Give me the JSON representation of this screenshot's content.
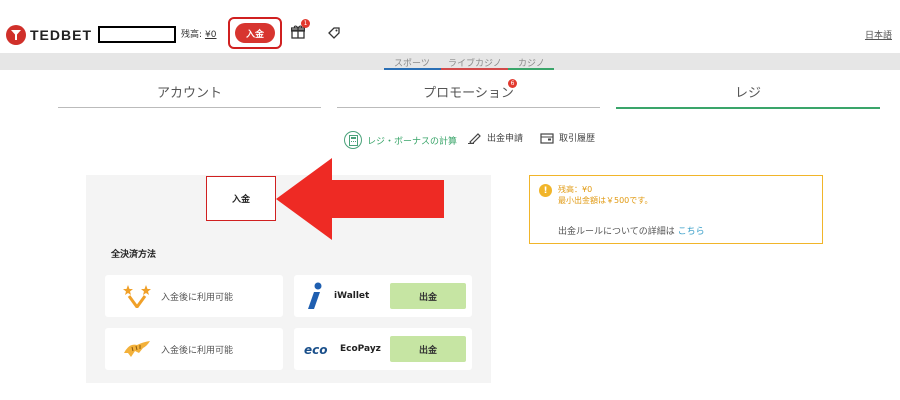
{
  "header": {
    "logo_text": "TEDBET",
    "balance_label": "残高:",
    "balance_value": "¥0",
    "deposit_label": "入金",
    "gift_badge": "1",
    "language": "日本語"
  },
  "top_nav": {
    "items": [
      {
        "label": "スポーツ",
        "color": "#2a6fb5"
      },
      {
        "label": "ライブカジノ",
        "color": "#d24a4a"
      },
      {
        "label": "カジノ",
        "color": "#3aa56a"
      }
    ]
  },
  "tabs": [
    {
      "label": "アカウント",
      "active": false
    },
    {
      "label": "プロモーション",
      "active": false,
      "badge": "6"
    },
    {
      "label": "レジ",
      "active": true
    }
  ],
  "sub_actions": [
    {
      "label": "レジ・ボーナスの計算",
      "icon": "calculator-icon"
    },
    {
      "label": "出金申請",
      "icon": "pen-icon"
    },
    {
      "label": "取引履歴",
      "icon": "wallet-icon"
    }
  ],
  "panel": {
    "deposit_tab": "入金",
    "section_title": "全決済方法",
    "left_cards": [
      {
        "label": "入金後に利用可能",
        "icon": "vip-stars-icon"
      },
      {
        "label": "入金後に利用可能",
        "icon": "tiger-icon"
      }
    ],
    "right_cards": [
      {
        "name": "iWallet",
        "button": "出金",
        "icon": "iwallet-logo"
      },
      {
        "name": "EcoPayz",
        "button": "出金",
        "icon": "ecopayz-logo"
      }
    ]
  },
  "info": {
    "balance_line": "残高：¥0",
    "min_line": "最小出金額は￥500です。",
    "rule_text": "出金ルールについての詳細は",
    "rule_link": "こちら"
  },
  "colors": {
    "brand_red": "#d7352f",
    "accent_green": "#3aa56a",
    "warning": "#f1b52a",
    "link": "#3a9fc9",
    "button_green": "#c6e5a3"
  }
}
